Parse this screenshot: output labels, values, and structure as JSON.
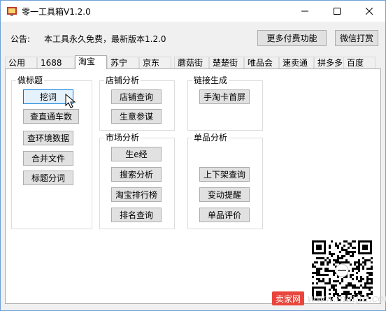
{
  "window": {
    "title": "零一工具箱V1.2.0",
    "icon": "app-icon",
    "controls": [
      "minimize-icon",
      "maximize-icon",
      "close-icon"
    ]
  },
  "notice": {
    "label": "公告:",
    "text": "本工具永久免费，最新版本1.2.0"
  },
  "header_buttons": {
    "more_paid": "更多付费功能",
    "wechat_tip": "微信打赏"
  },
  "tabs": [
    {
      "label": "公用",
      "active": false
    },
    {
      "label": "1688",
      "active": false
    },
    {
      "label": "淘宝",
      "active": true
    },
    {
      "label": "苏宁",
      "active": false
    },
    {
      "label": "京东",
      "active": false
    },
    {
      "label": "蘑菇街",
      "active": false
    },
    {
      "label": "楚楚街",
      "active": false
    },
    {
      "label": "唯品会",
      "active": false
    },
    {
      "label": "速卖通",
      "active": false
    },
    {
      "label": "拼多多",
      "active": false
    },
    {
      "label": "百度",
      "active": false
    }
  ],
  "groups": {
    "title_group": {
      "title": "做标题",
      "buttons": [
        "挖词",
        "查直通车数",
        "查环境数据",
        "合并文件",
        "标题分词"
      ]
    },
    "shop_analysis": {
      "title": "店铺分析",
      "buttons": [
        "店铺查询",
        "生意参谋"
      ]
    },
    "link_gen": {
      "title": "链接生成",
      "buttons": [
        "手淘卡首屏"
      ]
    },
    "market_analysis": {
      "title": "市场分析",
      "buttons": [
        "生e经",
        "搜索分析",
        "淘宝排行榜",
        "排名查询"
      ]
    },
    "item_analysis": {
      "title": "单品分析",
      "buttons": [
        "上下架查询",
        "变动提醒",
        "单品评价"
      ]
    }
  },
  "watermark": {
    "badge": "卖家网",
    "url": "www.maijia.com"
  },
  "colors": {
    "window_border": "#6f9fd8",
    "focus_border": "#0078d7",
    "watermark_red": "#e8453c"
  }
}
